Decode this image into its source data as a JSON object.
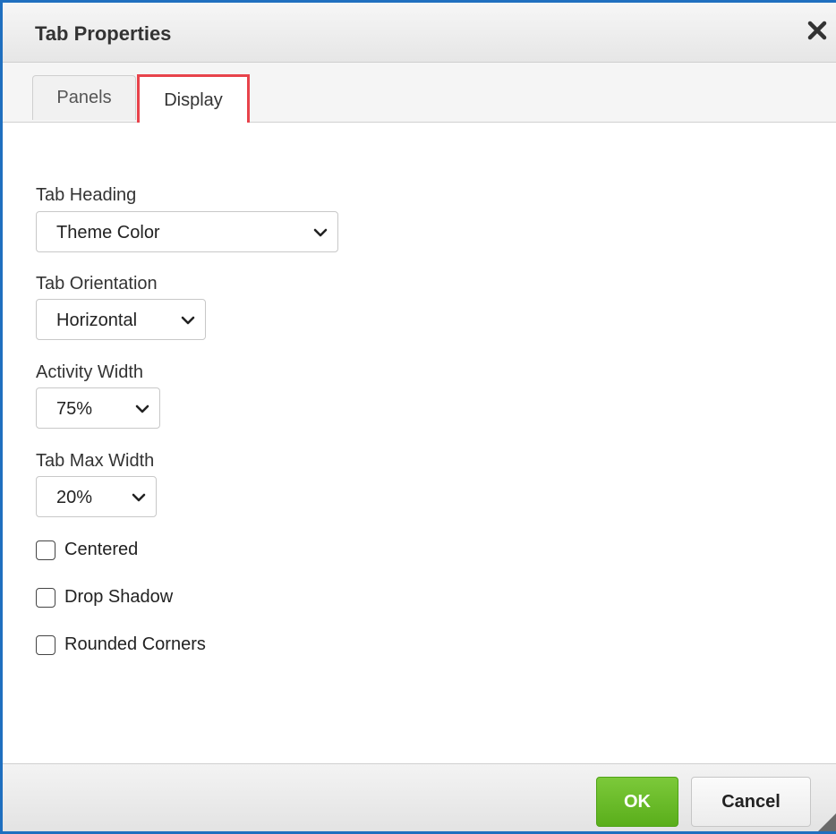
{
  "dialog": {
    "title": "Tab Properties",
    "close_icon": "close-icon"
  },
  "tabs": [
    {
      "label": "Panels",
      "active": false
    },
    {
      "label": "Display",
      "active": true,
      "highlighted": true
    }
  ],
  "fields": {
    "tab_heading": {
      "label": "Tab Heading",
      "value": "Theme Color"
    },
    "tab_orientation": {
      "label": "Tab Orientation",
      "value": "Horizontal"
    },
    "activity_width": {
      "label": "Activity Width",
      "value": "75%"
    },
    "tab_max_width": {
      "label": "Tab Max Width",
      "value": "20%"
    }
  },
  "checkboxes": [
    {
      "label": "Centered",
      "checked": false
    },
    {
      "label": "Drop Shadow",
      "checked": false
    },
    {
      "label": "Rounded Corners",
      "checked": false
    }
  ],
  "footer": {
    "ok_label": "OK",
    "cancel_label": "Cancel"
  },
  "colors": {
    "window_border": "#1f6fbf",
    "highlight": "#e8434b",
    "ok_button": "#6abb2a"
  }
}
